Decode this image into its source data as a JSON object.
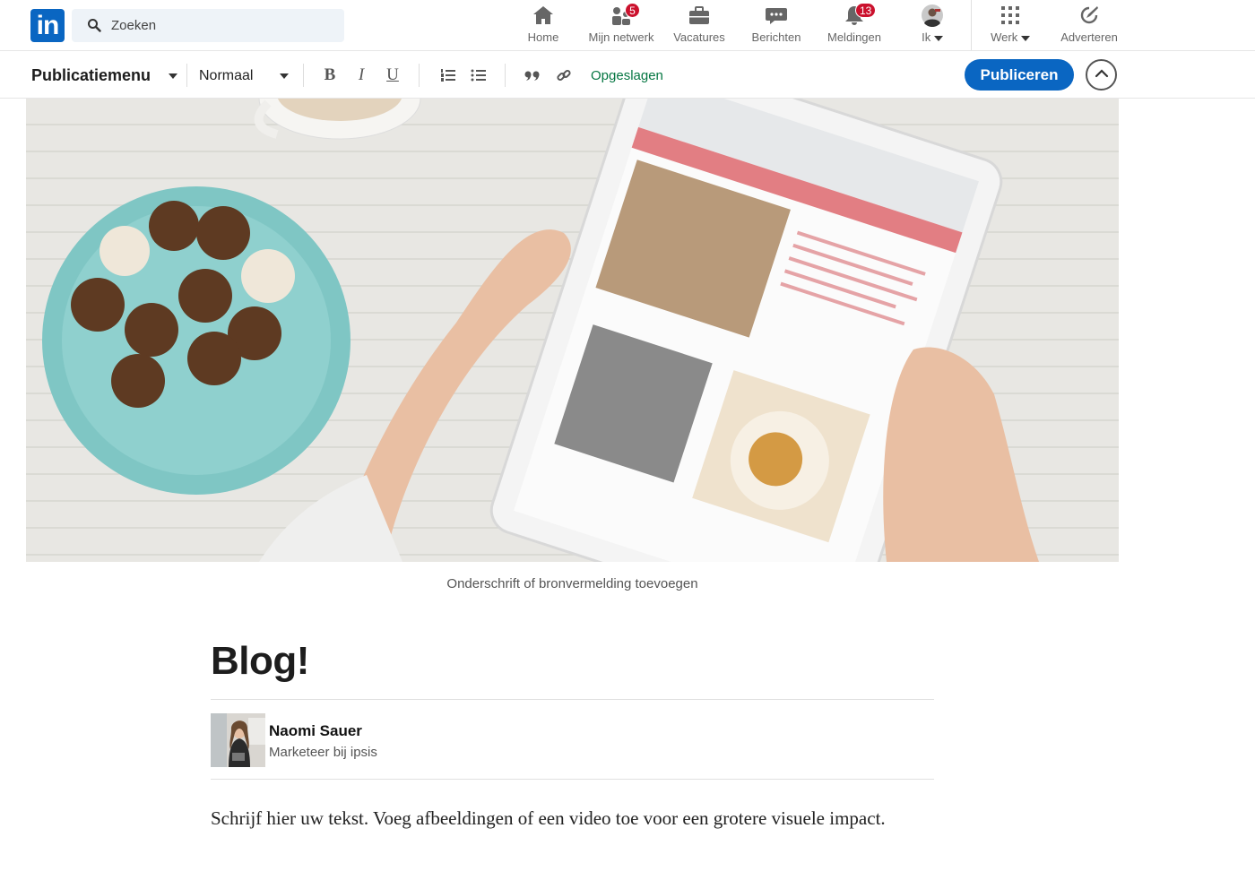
{
  "nav": {
    "logo_text": "in",
    "search_placeholder": "Zoeken",
    "items": [
      {
        "label": "Home",
        "icon": "home-icon"
      },
      {
        "label": "Mijn netwerk",
        "icon": "network-icon",
        "badge": "5"
      },
      {
        "label": "Vacatures",
        "icon": "briefcase-icon"
      },
      {
        "label": "Berichten",
        "icon": "messaging-icon"
      },
      {
        "label": "Meldingen",
        "icon": "bell-icon",
        "badge": "13"
      },
      {
        "label": "Ik",
        "icon": "profile-avatar-icon"
      },
      {
        "label": "Werk",
        "icon": "grid-icon"
      },
      {
        "label": "Adverteren",
        "icon": "compass-icon"
      }
    ]
  },
  "editor_toolbar": {
    "publication_menu": "Publicatiemenu",
    "text_style": "Normaal",
    "status": "Opgeslagen",
    "publish_label": "Publiceren"
  },
  "article": {
    "image_caption_placeholder": "Onderschrift of bronvermelding toevoegen",
    "title": "Blog!",
    "author_name": "Naomi Sauer",
    "author_role": "Marketeer bij ipsis",
    "body_placeholder": "Schrijf hier uw tekst. Voeg afbeeldingen of een video toe voor een grotere visuele impact."
  },
  "colors": {
    "brand": "#0a66c2",
    "saved_green": "#057642",
    "badge_red": "#cb112d"
  }
}
